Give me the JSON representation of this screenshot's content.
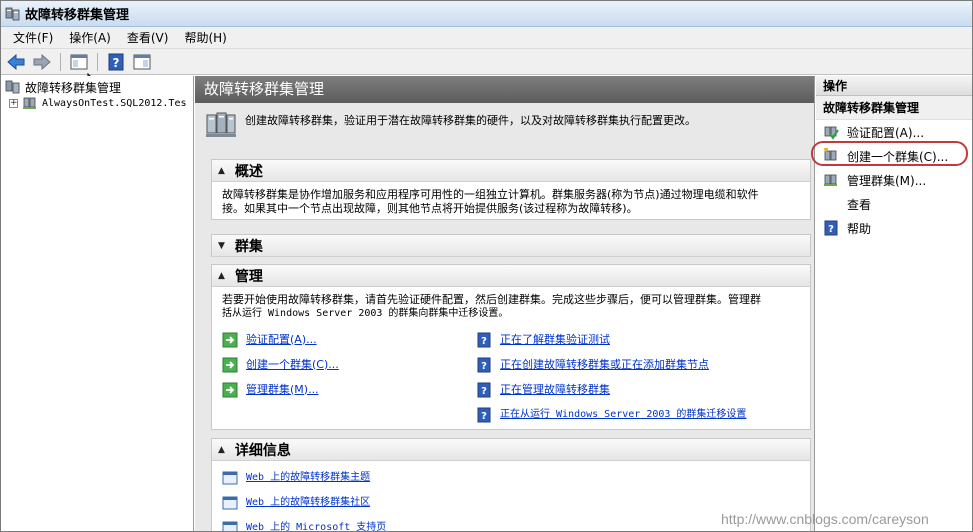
{
  "window": {
    "title": "故障转移群集管理"
  },
  "menu": [
    "文件(F)",
    "操作(A)",
    "查看(V)",
    "帮助(H)"
  ],
  "toolbar": {
    "icons": [
      "back-arrow-icon",
      "forward-arrow-icon",
      "console-tree-icon",
      "help-icon",
      "show-pane-icon"
    ]
  },
  "tree": {
    "root": "故障转移群集管理",
    "child": "AlwaysOnTest.SQL2012.Tes"
  },
  "main": {
    "header": "故障转移群集管理",
    "intro": "创建故障转移群集，验证用于潜在故障转移群集的硬件，以及对故障转移群集执行配置更改。",
    "overview": {
      "title": "概述",
      "line1": "故障转移群集是协作增加服务和应用程序可用性的一组独立计算机。群集服务器(称为节点)通过物理电缆和软件",
      "line2": "接。如果其中一个节点出现故障，则其他节点将开始提供服务(该过程称为故障转移)。"
    },
    "clusters": {
      "title": "群集"
    },
    "manage": {
      "title": "管理",
      "line1": "若要开始使用故障转移群集，请首先验证硬件配置，然后创建群集。完成这些步骤后，便可以管理群集。管理群",
      "line2": "括从运行 Windows Server 2003 的群集向群集中迁移设置。",
      "left_links": [
        "验证配置(A)...",
        "创建一个群集(C)...",
        "管理群集(M)..."
      ],
      "right_links": [
        "正在了解群集验证测试",
        "正在创建故障转移群集或正在添加群集节点",
        "正在管理故障转移群集",
        "正在从运行 Windows Server 2003 的群集迁移设置"
      ]
    },
    "details": {
      "title": "详细信息",
      "links": [
        "Web 上的故障转移群集主题",
        "Web 上的故障转移群集社区",
        "Web 上的 Microsoft 支持页"
      ]
    }
  },
  "actions": {
    "header": "操作",
    "subheader": "故障转移群集管理",
    "items": [
      "验证配置(A)...",
      "创建一个群集(C)...",
      "管理群集(M)...",
      "查看",
      "帮助"
    ]
  },
  "watermark": "http://www.cnblogs.com/careyson",
  "colors": {
    "link": "#0033cc",
    "highlight": "#c43a3a",
    "header_bg": "#6e6e6e"
  }
}
